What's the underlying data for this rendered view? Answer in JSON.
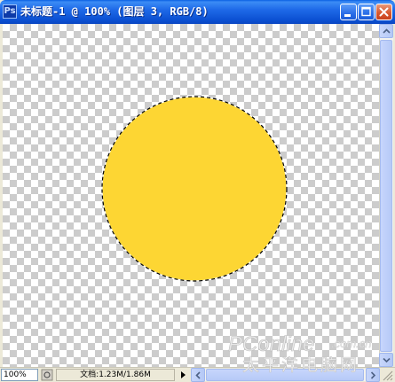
{
  "window": {
    "title": "未标题-1 @ 100% (图层 3, RGB/8)",
    "app_icon": "photoshop-icon",
    "controls": {
      "minimize_icon": "minimize-icon",
      "maximize_icon": "maximize-icon",
      "close_icon": "close-icon"
    }
  },
  "canvas": {
    "background": "transparency-checkerboard",
    "shape": {
      "type": "circle",
      "fill_color": "#fdd633",
      "selection": "marching-ants"
    }
  },
  "statusbar": {
    "zoom": "100%",
    "doc_info": "文档:1.23M/1.86M"
  },
  "watermark": {
    "brand": "PConline",
    "domain": ".com.cn",
    "cn_text": "太平洋电脑网"
  },
  "colors": {
    "titlebar_blue": "#0b4fd1",
    "circle_yellow": "#fdd633",
    "close_red": "#d9582f"
  }
}
